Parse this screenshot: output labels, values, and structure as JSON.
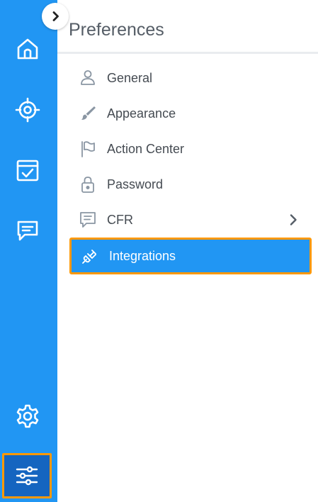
{
  "panel": {
    "title": "Preferences"
  },
  "rail": {
    "items": [
      {
        "name": "home",
        "icon": "home-icon"
      },
      {
        "name": "target",
        "icon": "target-icon"
      },
      {
        "name": "tasks",
        "icon": "calendar-check-icon"
      },
      {
        "name": "messages",
        "icon": "chat-icon"
      },
      {
        "name": "settings",
        "icon": "gear-icon"
      },
      {
        "name": "preferences",
        "icon": "sliders-icon"
      }
    ]
  },
  "menu": {
    "items": [
      {
        "label": "General",
        "icon": "user-icon"
      },
      {
        "label": "Appearance",
        "icon": "brush-icon"
      },
      {
        "label": "Action Center",
        "icon": "flag-icon"
      },
      {
        "label": "Password",
        "icon": "lock-icon"
      },
      {
        "label": "CFR",
        "icon": "message-list-icon"
      },
      {
        "label": "Integrations",
        "icon": "plug-icon"
      }
    ]
  },
  "colors": {
    "rail_bg": "#2196f3",
    "highlight": "#ff9800",
    "selected_bg": "#2196f3",
    "active_rail_bg": "#1565c0"
  }
}
